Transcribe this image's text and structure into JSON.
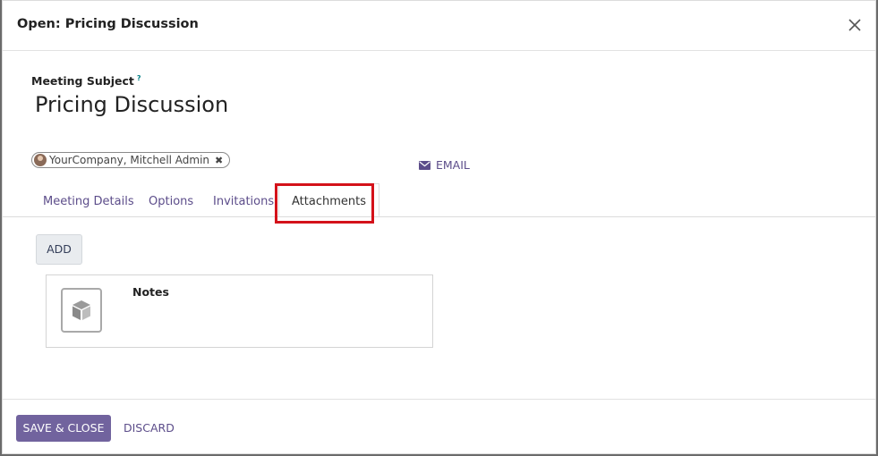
{
  "dialog": {
    "title": "Open: Pricing Discussion",
    "close_icon": "close-icon"
  },
  "form": {
    "subject_label": "Meeting Subject",
    "help_mark": "?",
    "subject_value": "Pricing Discussion",
    "attendee": "YourCompany, Mitchell Admin",
    "attendee_remove": "✖",
    "email_label": "EMAIL",
    "email_icon": "envelope-icon"
  },
  "tabs": [
    {
      "label": "Meeting Details",
      "active": false
    },
    {
      "label": "Options",
      "active": false
    },
    {
      "label": "Invitations",
      "active": false
    },
    {
      "label": "Attachments",
      "active": true
    }
  ],
  "attachments": {
    "add_label": "ADD",
    "items": [
      {
        "title": "Notes",
        "icon": "document-placeholder-icon"
      }
    ]
  },
  "footer": {
    "save_label": "SAVE & CLOSE",
    "discard_label": "DISCARD"
  },
  "colors": {
    "primary": "#71639e",
    "link": "#5c4d8a",
    "highlight": "#d4121a"
  }
}
